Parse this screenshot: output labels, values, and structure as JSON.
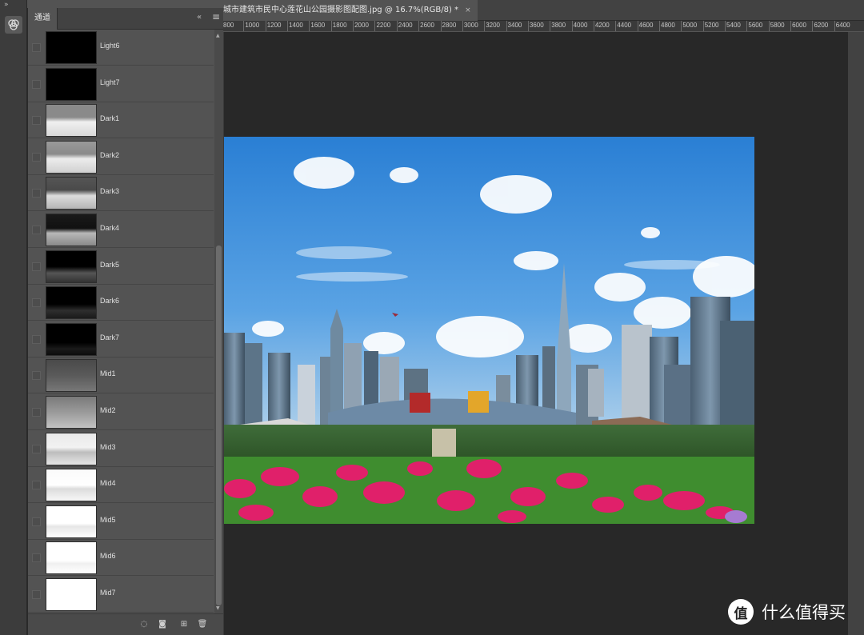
{
  "panel": {
    "tab_label": "通道",
    "collapse_icon": "double-chevron-left-icon",
    "menu_icon": "hamburger-menu-icon"
  },
  "channels": [
    {
      "name": "Light6",
      "tone": "light6"
    },
    {
      "name": "Light7",
      "tone": "light7"
    },
    {
      "name": "Dark1",
      "tone": "dark1"
    },
    {
      "name": "Dark2",
      "tone": "dark2"
    },
    {
      "name": "Dark3",
      "tone": "dark3"
    },
    {
      "name": "Dark4",
      "tone": "dark4"
    },
    {
      "name": "Dark5",
      "tone": "dark5"
    },
    {
      "name": "Dark6",
      "tone": "dark6"
    },
    {
      "name": "Dark7",
      "tone": "dark7"
    },
    {
      "name": "Mid1",
      "tone": "mid1"
    },
    {
      "name": "Mid2",
      "tone": "mid2"
    },
    {
      "name": "Mid3",
      "tone": "mid3"
    },
    {
      "name": "Mid4",
      "tone": "mid4"
    },
    {
      "name": "Mid5",
      "tone": "mid5"
    },
    {
      "name": "Mid6",
      "tone": "mid6"
    },
    {
      "name": "Mid7",
      "tone": "mid7"
    }
  ],
  "footer_buttons": [
    {
      "name": "load-channel-as-selection-button",
      "icon": "dotted-circle-icon",
      "glyph": "◌"
    },
    {
      "name": "save-selection-as-channel-button",
      "icon": "mask-icon",
      "glyph": "◙"
    },
    {
      "name": "new-channel-button",
      "icon": "plus-square-icon",
      "glyph": "⊞"
    },
    {
      "name": "delete-channel-button",
      "icon": "trash-icon",
      "glyph": "🗑"
    }
  ],
  "document": {
    "tab_title": "城市建筑市民中心莲花山公园摄影图配图.jpg @ 16.7%(RGB/8) *",
    "close_glyph": "×"
  },
  "ruler": {
    "labels": [
      "800",
      "1000",
      "1200",
      "1400",
      "1600",
      "1800",
      "2000",
      "2200",
      "2400",
      "2600",
      "2800",
      "3000",
      "3200",
      "3400",
      "3600",
      "3800",
      "4000",
      "4200",
      "4400",
      "4600",
      "4800",
      "5000",
      "5200",
      "5400",
      "5600",
      "5800",
      "6000",
      "6200",
      "6400"
    ]
  },
  "watermark": {
    "logo_glyph": "值",
    "text": "什么值得买"
  },
  "colors": {
    "panel_bg": "#535353",
    "canvas_bg": "#282828",
    "sky_top": "#1f6fc5",
    "flowers": "#e0206a"
  }
}
